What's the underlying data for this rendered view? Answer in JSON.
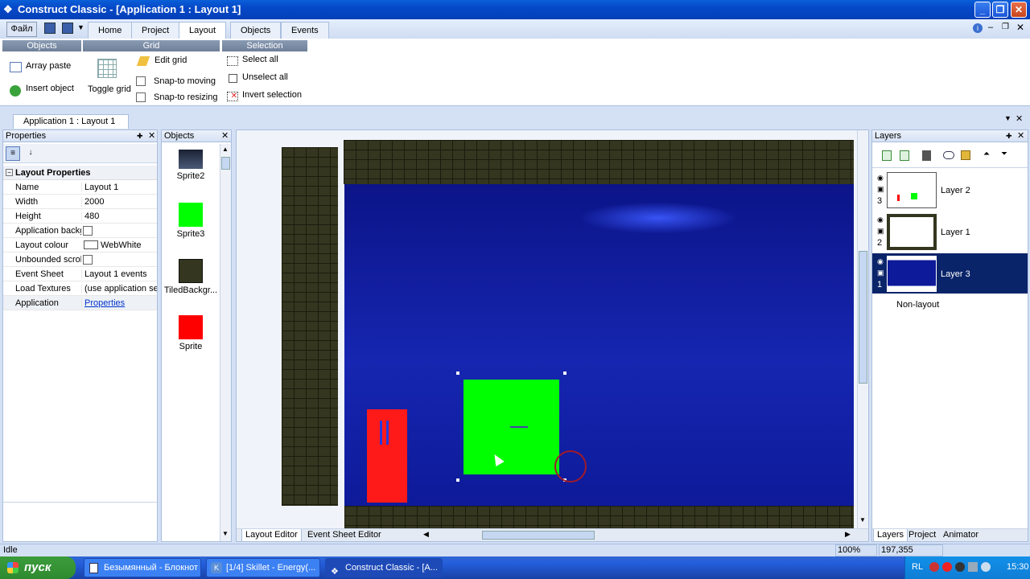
{
  "window": {
    "title": "Construct Classic - [Application 1 : Layout 1]",
    "min": "_",
    "max": "❐",
    "close": "✕"
  },
  "ribbon": {
    "file_label": "Файл",
    "tabs": [
      "Home",
      "Project",
      "Layout",
      "Objects",
      "Events"
    ],
    "active_tab": "Layout",
    "groups": {
      "objects": "Objects",
      "grid": "Grid",
      "selection": "Selection"
    },
    "objects_items": {
      "array_paste": "Array paste",
      "insert_object": "Insert object"
    },
    "grid_items": {
      "toggle_grid": "Toggle grid",
      "edit_grid": "Edit grid",
      "snap_moving": "Snap-to moving",
      "snap_resizing": "Snap-to resizing"
    },
    "selection_items": {
      "select_all": "Select all",
      "unselect_all": "Unselect all",
      "invert": "Invert selection"
    }
  },
  "doc_tab": "Application 1 : Layout 1",
  "properties": {
    "title": "Properties",
    "section": "Layout Properties",
    "rows": [
      {
        "key": "Name",
        "value": "Layout 1"
      },
      {
        "key": "Width",
        "value": "2000"
      },
      {
        "key": "Height",
        "value": "480"
      },
      {
        "key": "Application backg",
        "value": ""
      },
      {
        "key": "Layout colour",
        "value": "WebWhite"
      },
      {
        "key": "Unbounded scrolli",
        "value": ""
      },
      {
        "key": "Event Sheet",
        "value": "Layout 1 events"
      },
      {
        "key": "Load Textures",
        "value": "(use application sett"
      },
      {
        "key": "Application",
        "value": "Properties"
      }
    ]
  },
  "objects": {
    "title": "Objects",
    "items": [
      {
        "name": "Sprite2",
        "color": "#2a3447"
      },
      {
        "name": "Sprite3",
        "color": "#00ff00"
      },
      {
        "name": "TiledBackgr...",
        "color": "#34361f"
      },
      {
        "name": "Sprite",
        "color": "#ff0000"
      }
    ]
  },
  "editor": {
    "tabs": [
      "Layout Editor",
      "Event Sheet Editor"
    ],
    "colors": {
      "sky": "#0d1a99",
      "tile": "#34361f",
      "green": "#00ff00",
      "red": "#ff1a1a"
    }
  },
  "layers": {
    "title": "Layers",
    "items": [
      {
        "num": "3",
        "name": "Layer 2"
      },
      {
        "num": "2",
        "name": "Layer 1"
      },
      {
        "num": "1",
        "name": "Layer 3"
      }
    ],
    "non_layout": "Non-layout",
    "bottom_tabs": [
      "Layers",
      "Project",
      "Animator"
    ]
  },
  "status": {
    "text": "Idle",
    "zoom": "100%",
    "coords": "197,355"
  },
  "taskbar": {
    "start": "пуск",
    "tasks": [
      "Безымянный - Блокнот",
      "[1/4] Skillet - Energy(...",
      "Construct Classic - [A..."
    ],
    "lang": "RL",
    "time": "15:30"
  }
}
